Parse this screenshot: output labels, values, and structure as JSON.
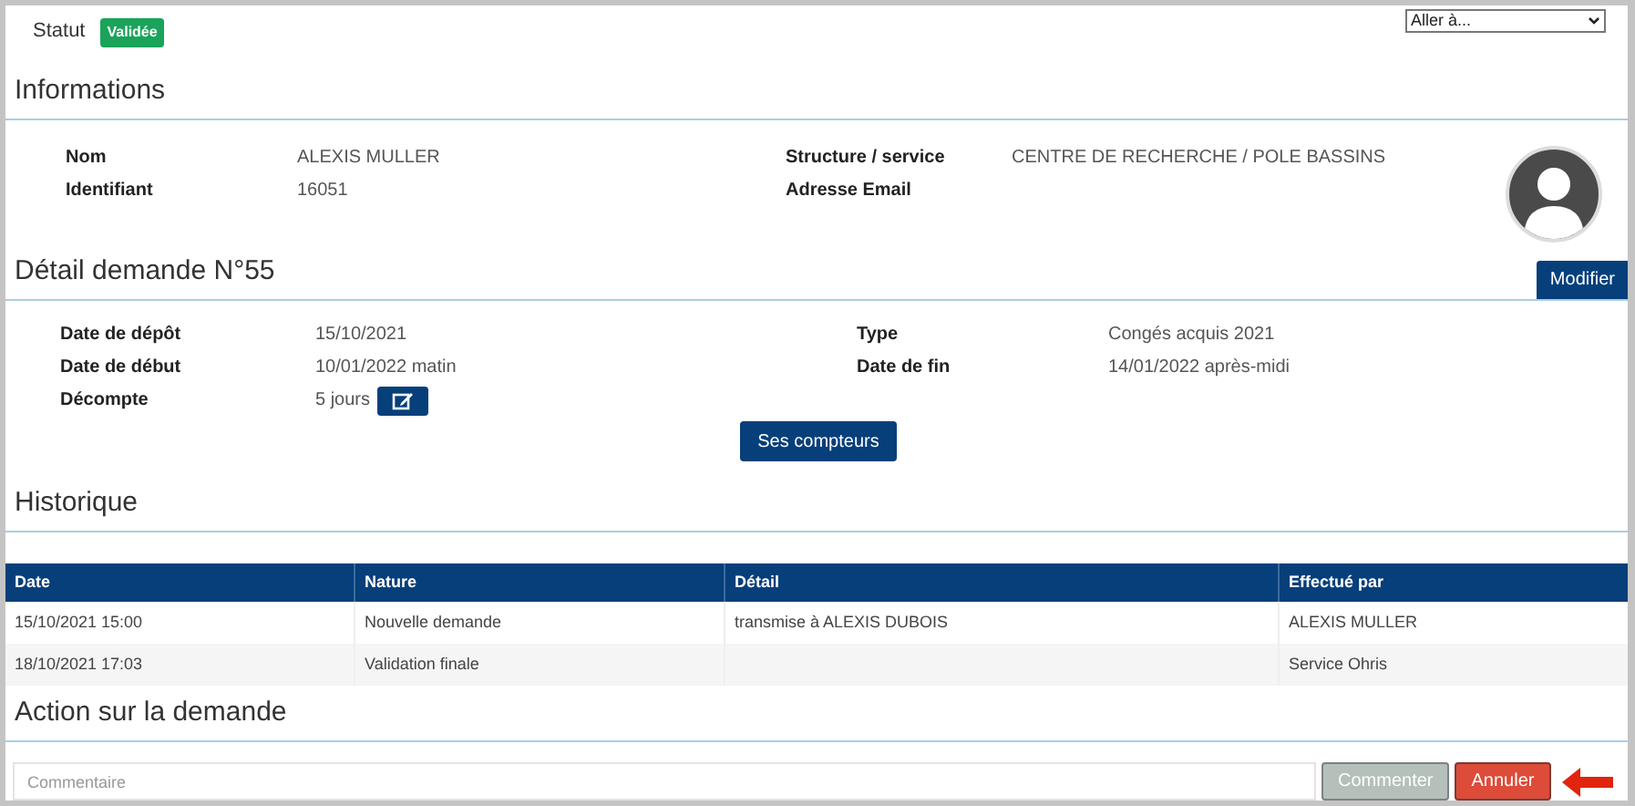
{
  "status": {
    "label": "Statut",
    "badge": "Validée"
  },
  "goto": {
    "value": "Aller à..."
  },
  "informations": {
    "title": "Informations",
    "left": [
      {
        "label": "Nom",
        "value": "ALEXIS MULLER"
      },
      {
        "label": "Identifiant",
        "value": "16051"
      }
    ],
    "right": [
      {
        "label": "Structure / service",
        "value": "CENTRE DE RECHERCHE / POLE BASSINS"
      },
      {
        "label": "Adresse Email"
      }
    ]
  },
  "detail": {
    "title": "Détail demande N°55",
    "modify_button": "Modifier",
    "left": [
      {
        "label": "Date de dépôt",
        "value": "15/10/2021"
      },
      {
        "label": "Date de début",
        "value": "10/01/2022 matin"
      },
      {
        "label": "Décompte",
        "value": "5 jours",
        "kind": "editable"
      }
    ],
    "right": [
      {
        "label": "Type",
        "value": "Congés acquis 2021"
      },
      {
        "label": "Date de fin",
        "value": "14/01/2022 après-midi"
      }
    ],
    "counters_button": "Ses compteurs"
  },
  "historique": {
    "title": "Historique",
    "columns": [
      "Date",
      "Nature",
      "Détail",
      "Effectué par"
    ],
    "rows": [
      [
        "15/10/2021 15:00",
        "Nouvelle demande",
        "transmise à ALEXIS DUBOIS",
        "ALEXIS MULLER"
      ],
      [
        "18/10/2021 17:03",
        "Validation finale",
        "",
        "Service Ohris"
      ]
    ]
  },
  "action": {
    "title": "Action sur la demande",
    "comment": {
      "placeholder": "Commentaire"
    },
    "buttons": [
      {
        "label": "Commenter",
        "kind": "neutral",
        "disabled": true
      },
      {
        "label": "Annuler",
        "kind": "danger",
        "disabled": false
      }
    ]
  }
}
